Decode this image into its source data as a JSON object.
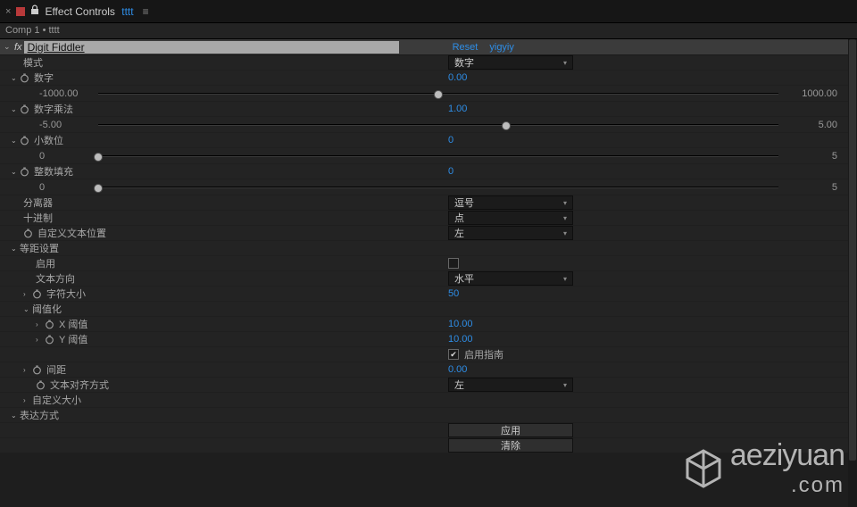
{
  "tab": {
    "title": "Effect Controls",
    "arg": "tttt"
  },
  "breadcrumb": "Comp 1 • tttt",
  "effect": {
    "name": "Digit Fiddler",
    "reset": "Reset",
    "about": "yigyiy"
  },
  "props": {
    "mode": {
      "label": "模式",
      "value": "数字"
    },
    "number": {
      "label": "数字",
      "value": "0.00",
      "min": "-1000.00",
      "max": "1000.00",
      "pos": 50
    },
    "mult": {
      "label": "数字乘法",
      "value": "1.00",
      "min": "-5.00",
      "max": "5.00",
      "pos": 60
    },
    "decimals": {
      "label": "小数位",
      "value": "0",
      "min": "0",
      "max": "5",
      "pos": 0
    },
    "intpad": {
      "label": "整数填充",
      "value": "0",
      "min": "0",
      "max": "5",
      "pos": 0
    },
    "separator": {
      "label": "分离器",
      "value": "逗号"
    },
    "decimal": {
      "label": "十进制",
      "value": "点"
    },
    "customTextPos": {
      "label": "自定义文本位置",
      "value": "左"
    },
    "mono": {
      "group": "等距设置",
      "enable": {
        "label": "启用",
        "checked": false
      },
      "direction": {
        "label": "文本方向",
        "value": "水平"
      },
      "charSize": {
        "label": "字符大小",
        "value": "50"
      },
      "threshold": {
        "group": "阈值化",
        "x": {
          "label": "X 阈值",
          "value": "10.00"
        },
        "y": {
          "label": "Y 阈值",
          "value": "10.00"
        },
        "guides": {
          "label": "启用指南",
          "checked": true
        }
      },
      "spacing": {
        "label": "间距",
        "value": "0.00"
      },
      "align": {
        "label": "文本对齐方式",
        "value": "左"
      },
      "customSize": {
        "label": "自定义大小"
      }
    },
    "expr": {
      "group": "表达方式",
      "apply": "应用",
      "clear": "清除"
    }
  },
  "watermark": {
    "line1": "aeziyuan",
    "line2": ".com"
  }
}
